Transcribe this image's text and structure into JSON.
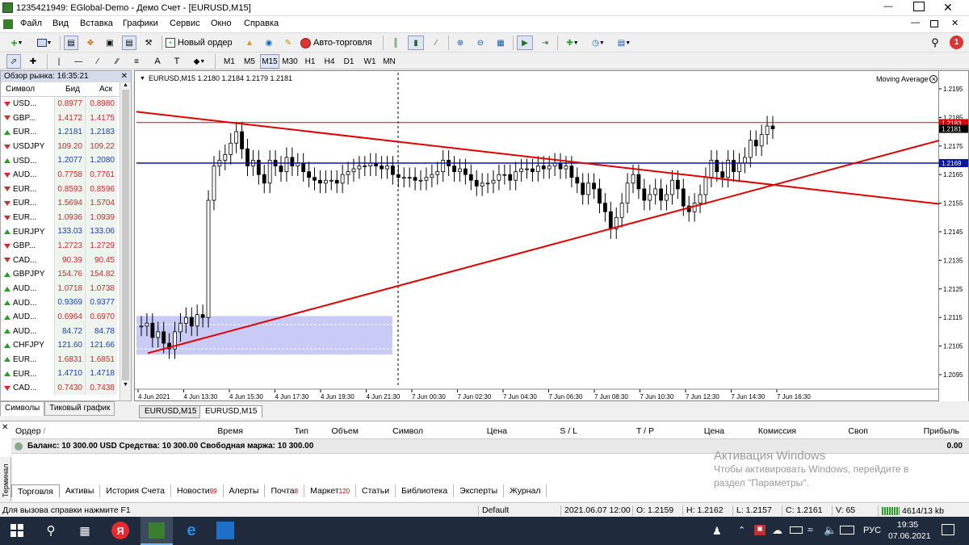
{
  "window": {
    "title": "1235421949: EGlobal-Demo - Демо Счет - [EURUSD,M15]"
  },
  "menu": [
    "Файл",
    "Вид",
    "Вставка",
    "Графики",
    "Сервис",
    "Окно",
    "Справка"
  ],
  "toolbar": {
    "new_order": "Новый ордер",
    "auto_trading": "Авто-торговля",
    "notification_count": "1"
  },
  "timeframes": [
    "M1",
    "M5",
    "M15",
    "M30",
    "H1",
    "H4",
    "D1",
    "W1",
    "MN"
  ],
  "active_timeframe": "M15",
  "market_watch": {
    "title": "Обзор рынка: 16:35:21",
    "col_symbol": "Символ",
    "col_bid": "Бид",
    "col_ask": "Аск",
    "rows": [
      {
        "symbol": "USD...",
        "bid": "0.8977",
        "ask": "0.8980",
        "dir": "down",
        "color": "#d42a2a"
      },
      {
        "symbol": "GBP...",
        "bid": "1.4172",
        "ask": "1.4175",
        "dir": "down",
        "color": "#d42a2a"
      },
      {
        "symbol": "EUR...",
        "bid": "1.2181",
        "ask": "1.2183",
        "dir": "up",
        "color": "#1a3fbf"
      },
      {
        "symbol": "USDJPY",
        "bid": "109.20",
        "ask": "109.22",
        "dir": "down",
        "color": "#d42a2a"
      },
      {
        "symbol": "USD...",
        "bid": "1.2077",
        "ask": "1.2080",
        "dir": "up",
        "color": "#1a3fbf"
      },
      {
        "symbol": "AUD...",
        "bid": "0.7758",
        "ask": "0.7761",
        "dir": "down",
        "color": "#d42a2a"
      },
      {
        "symbol": "EUR...",
        "bid": "0.8593",
        "ask": "0.8596",
        "dir": "down",
        "color": "#d42a2a"
      },
      {
        "symbol": "EUR...",
        "bid": "1.5694",
        "ask": "1.5704",
        "dir": "down",
        "color": "#d42a2a"
      },
      {
        "symbol": "EUR...",
        "bid": "1.0936",
        "ask": "1.0939",
        "dir": "down",
        "color": "#d42a2a"
      },
      {
        "symbol": "EURJPY",
        "bid": "133.03",
        "ask": "133.06",
        "dir": "up",
        "color": "#1a3fbf"
      },
      {
        "symbol": "GBP...",
        "bid": "1.2723",
        "ask": "1.2729",
        "dir": "down",
        "color": "#d42a2a"
      },
      {
        "symbol": "CAD...",
        "bid": "90.39",
        "ask": "90.45",
        "dir": "down",
        "color": "#d42a2a"
      },
      {
        "symbol": "GBPJPY",
        "bid": "154.76",
        "ask": "154.82",
        "dir": "up",
        "color": "#d42a2a"
      },
      {
        "symbol": "AUD...",
        "bid": "1.0718",
        "ask": "1.0738",
        "dir": "up",
        "color": "#d42a2a"
      },
      {
        "symbol": "AUD...",
        "bid": "0.9369",
        "ask": "0.9377",
        "dir": "up",
        "color": "#1a3fbf"
      },
      {
        "symbol": "AUD...",
        "bid": "0.6964",
        "ask": "0.6970",
        "dir": "up",
        "color": "#d42a2a"
      },
      {
        "symbol": "AUD...",
        "bid": "84.72",
        "ask": "84.78",
        "dir": "up",
        "color": "#1a3fbf"
      },
      {
        "symbol": "CHFJPY",
        "bid": "121.60",
        "ask": "121.66",
        "dir": "up",
        "color": "#1a3fbf"
      },
      {
        "symbol": "EUR...",
        "bid": "1.6831",
        "ask": "1.6851",
        "dir": "up",
        "color": "#d42a2a"
      },
      {
        "symbol": "EUR...",
        "bid": "1.4710",
        "ask": "1.4718",
        "dir": "up",
        "color": "#1a3fbf"
      },
      {
        "symbol": "CAD...",
        "bid": "0.7430",
        "ask": "0.7438",
        "dir": "down",
        "color": "#d42a2a"
      }
    ],
    "tabs": [
      "Символы",
      "Тиковый график"
    ]
  },
  "chart": {
    "header": "EURUSD,M15  1.2180 1.2184 1.2179 1.2181",
    "indicator": "Moving Average",
    "price_labels": [
      "1.2195",
      "1.2185",
      "1.2175",
      "1.2165",
      "1.2155",
      "1.2145",
      "1.2135",
      "1.2125",
      "1.2115",
      "1.2105",
      "1.2095"
    ],
    "time_labels": [
      "4 Jun 2021",
      "4 Jun 13:30",
      "4 Jun 15:30",
      "4 Jun 17:30",
      "4 Jun 19:30",
      "4 Jun 21:30",
      "7 Jun 00:30",
      "7 Jun 02:30",
      "7 Jun 04:30",
      "7 Jun 06:30",
      "7 Jun 08:30",
      "7 Jun 10:30",
      "7 Jun 12:30",
      "7 Jun 14:30",
      "7 Jun 16:30"
    ],
    "ask_level": "1.2183",
    "bid_level": "1.2181",
    "hline_level": "1.2169",
    "colors": {
      "bull": "#ffffff",
      "bear": "#000000",
      "red_line": "#e00000",
      "blue_line": "#0a14a0",
      "zone": "#c8cbf5"
    },
    "tabs": [
      "EURUSD,M15",
      "EURUSD,M15"
    ]
  },
  "terminal": {
    "columns": [
      "Ордер",
      "Время",
      "Тип",
      "Объем",
      "Символ",
      "Цена",
      "S / L",
      "T / P",
      "Цена",
      "Комиссия",
      "Своп",
      "Прибыль"
    ],
    "balance_text": "Баланс: 10 300.00 USD  Средства: 10 300.00  Свободная маржа: 10 300.00",
    "profit_total": "0.00",
    "side_label": "Терминал",
    "tabs": [
      {
        "label": "Торговля",
        "badge": ""
      },
      {
        "label": "Активы",
        "badge": ""
      },
      {
        "label": "История Счета",
        "badge": ""
      },
      {
        "label": "Новости",
        "badge": "99"
      },
      {
        "label": "Алерты",
        "badge": ""
      },
      {
        "label": "Почта",
        "badge": "8"
      },
      {
        "label": "Маркет",
        "badge": "120"
      },
      {
        "label": "Статьи",
        "badge": ""
      },
      {
        "label": "Библиотека",
        "badge": ""
      },
      {
        "label": "Эксперты",
        "badge": ""
      },
      {
        "label": "Журнал",
        "badge": ""
      }
    ]
  },
  "activation": {
    "title": "Активация Windows",
    "line1": "Чтобы активировать Windows, перейдите в",
    "line2": "раздел \"Параметры\"."
  },
  "status": {
    "help": "Для вызова справки нажмите F1",
    "profile": "Default",
    "datetime": "2021.06.07 12:00",
    "open": "O: 1.2159",
    "high": "H: 1.2162",
    "low": "L: 1.2157",
    "close": "C: 1.2161",
    "volume": "V: 65",
    "traffic": "4614/13 kb"
  },
  "taskbar": {
    "lang": "РУС",
    "time": "19:35",
    "date": "07.06.2021"
  }
}
